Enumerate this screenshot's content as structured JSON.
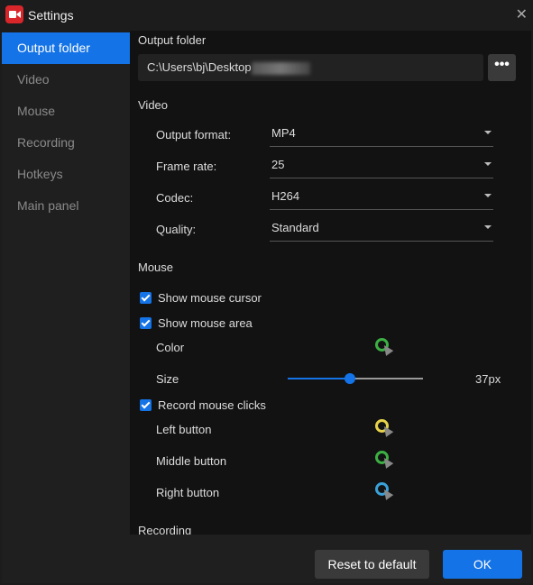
{
  "window": {
    "title": "Settings",
    "close_icon": "close-icon"
  },
  "sidebar": {
    "items": [
      {
        "label": "Output folder",
        "active": true
      },
      {
        "label": "Video"
      },
      {
        "label": "Mouse"
      },
      {
        "label": "Recording"
      },
      {
        "label": "Hotkeys"
      },
      {
        "label": "Main panel"
      }
    ]
  },
  "output": {
    "heading": "Output folder",
    "path": "C:\\Users\\bj\\Desktop",
    "more_label": "•••"
  },
  "video": {
    "heading": "Video",
    "fields": [
      {
        "label": "Output format:",
        "value": "MP4"
      },
      {
        "label": "Frame rate:",
        "value": "25"
      },
      {
        "label": "Codec:",
        "value": "H264"
      },
      {
        "label": "Quality:",
        "value": "Standard"
      }
    ]
  },
  "mouse": {
    "heading": "Mouse",
    "show_cursor": {
      "label": "Show mouse cursor",
      "checked": true
    },
    "show_area": {
      "label": "Show mouse area",
      "checked": true
    },
    "color_label": "Color",
    "color": "#3cb043",
    "size_label": "Size",
    "size_value": "37px",
    "size_fraction": 0.46,
    "record_clicks": {
      "label": "Record mouse clicks",
      "checked": true
    },
    "buttons": [
      {
        "label": "Left button",
        "color": "#e6d24a"
      },
      {
        "label": "Middle button",
        "color": "#3cb043"
      },
      {
        "label": "Right button",
        "color": "#3aa0d8"
      }
    ]
  },
  "recording": {
    "heading": "Recording"
  },
  "footer": {
    "reset_label": "Reset to default",
    "ok_label": "OK"
  },
  "colors": {
    "accent": "#1473e6"
  }
}
